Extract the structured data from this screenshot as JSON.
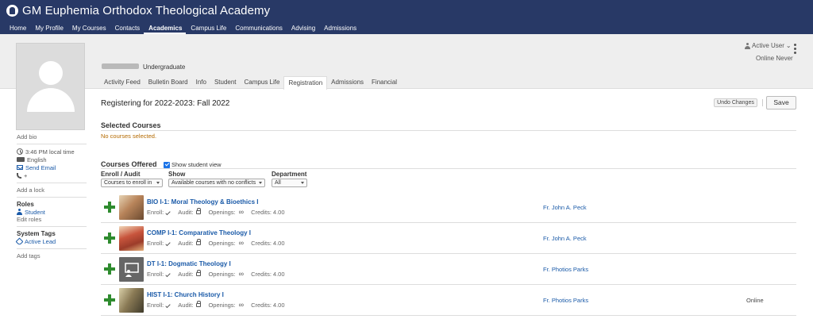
{
  "app": {
    "title": "GM Euphemia Orthodox Theological Academy",
    "brand_icon": "seal-logo-icon",
    "colors": {
      "nav_bg": "#283966",
      "link": "#1a5aa8",
      "add_green": "#2e8b2e",
      "warning": "#b46a00"
    }
  },
  "nav": {
    "items": [
      {
        "label": "Home"
      },
      {
        "label": "My Profile"
      },
      {
        "label": "My Courses"
      },
      {
        "label": "Contacts"
      },
      {
        "label": "Academics",
        "active": true
      },
      {
        "label": "Campus Life"
      },
      {
        "label": "Communications"
      },
      {
        "label": "Advising"
      },
      {
        "label": "Admissions"
      }
    ]
  },
  "profile": {
    "level": "Undergraduate",
    "user_menu": "Active User",
    "online_status": "Online Never",
    "tabs": [
      {
        "label": "Activity Feed"
      },
      {
        "label": "Bulletin Board"
      },
      {
        "label": "Info"
      },
      {
        "label": "Student"
      },
      {
        "label": "Campus Life"
      },
      {
        "label": "Registration",
        "active": true
      },
      {
        "label": "Admissions"
      },
      {
        "label": "Financial"
      }
    ]
  },
  "sidebar": {
    "add_bio": "Add bio",
    "local_time": "3:46 PM local time",
    "language": "English",
    "send_email": "Send Email",
    "phone": "+",
    "add_lock": "Add a lock",
    "roles_heading": "Roles",
    "role": "Student",
    "edit_roles": "Edit roles",
    "tags_heading": "System Tags",
    "tag": "Active Lead",
    "add_tags": "Add tags"
  },
  "registration": {
    "title": "Registering for 2022-2023: Fall 2022",
    "undo_label": "Undo Changes",
    "save_label": "Save",
    "selected_heading": "Selected Courses",
    "no_courses": "No courses selected.",
    "offered_heading": "Courses Offered",
    "show_student_view": "Show student view",
    "show_student_view_checked": true
  },
  "filters": {
    "enroll_audit": {
      "label": "Enroll / Audit",
      "value": "Courses to enroll in"
    },
    "show": {
      "label": "Show",
      "value": "Available courses with no conflicts"
    },
    "department": {
      "label": "Department",
      "value": "All"
    }
  },
  "course_labels": {
    "enroll": "Enroll:",
    "audit": "Audit:",
    "openings": "Openings:",
    "credits_prefix": "Credits:"
  },
  "courses": [
    {
      "code": "BIO I-1: Moral Theology & Bioethics I",
      "credits": "4.00",
      "instructor": "Fr. John A. Peck",
      "mode": "",
      "thumb_color": "#b8845a"
    },
    {
      "code": "COMP I-1: Comparative Theology I",
      "credits": "4.00",
      "instructor": "Fr. John A. Peck",
      "mode": "",
      "thumb_color": "#c8553d"
    },
    {
      "code": "DT I-1: Dogmatic Theology I",
      "credits": "4.00",
      "instructor": "Fr. Photios Parks",
      "mode": "",
      "thumb_color": "#666666"
    },
    {
      "code": "HIST I-1: Church History I",
      "credits": "4.00",
      "instructor": "Fr. Photios Parks",
      "mode": "Online",
      "thumb_color": "#8a7a55"
    }
  ]
}
